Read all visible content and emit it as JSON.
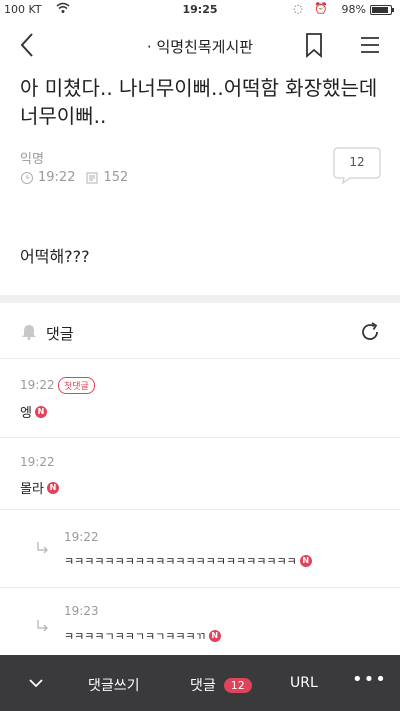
{
  "status_bar": {
    "carrier": "100 KT",
    "time": "19:25",
    "battery": "98%"
  },
  "nav": {
    "title": "· 익명친목게시판"
  },
  "post": {
    "title": "아 미쳤다.. 나너무이뻐..어떡함 화장했는데 너무이뻐..",
    "author": "익명",
    "time": "19:22",
    "views": "152",
    "comment_count": "12",
    "body": "어떡해???"
  },
  "comments_section": {
    "label": "댓글"
  },
  "comments": [
    {
      "time": "19:22",
      "badge": "첫댓글",
      "text": "엥",
      "new_mark": "N",
      "is_reply": false
    },
    {
      "time": "19:22",
      "text": "몰라",
      "new_mark": "N",
      "is_reply": false
    },
    {
      "time": "19:22",
      "text": "ㅋㅋㅋㅋㅋㅋㅋㅋㅋㅋㅋㅋㅋㅋㅋㅋㅋㅋㅋㅋㅋㅋㅋ",
      "new_mark": "N",
      "is_reply": true
    },
    {
      "time": "19:23",
      "text": "ㅋㅋㅋㅋㄱㅋㅋㄱㅋㄱㅋㅋㅋㄲ",
      "new_mark": "N",
      "is_reply": true
    }
  ],
  "bottom_bar": {
    "write_label": "댓글쓰기",
    "comments_label": "댓글",
    "comments_count": "12",
    "url_label": "URL",
    "more_label": "•••"
  },
  "colors": {
    "accent": "#e0435a",
    "bottom_bar_bg": "#3a3a3d",
    "muted_text": "#9a9a9a"
  }
}
